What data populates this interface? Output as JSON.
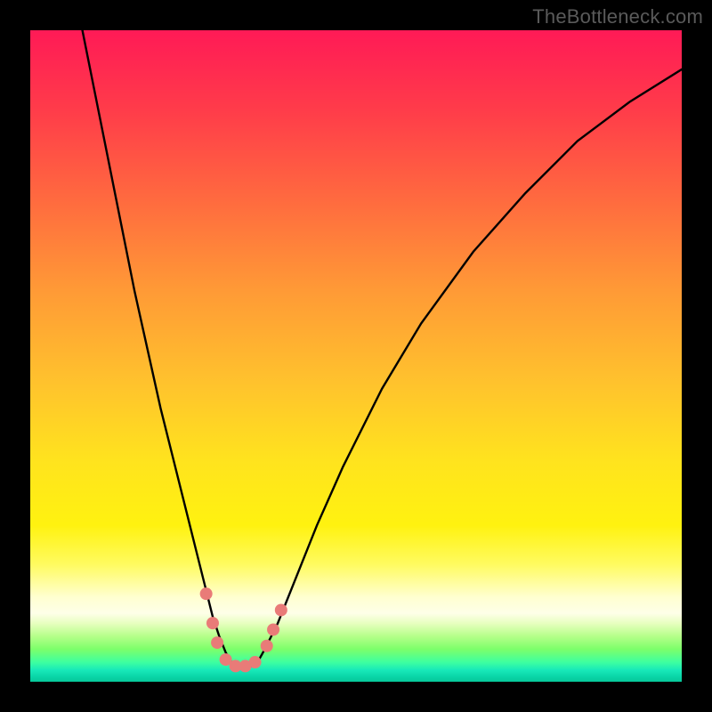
{
  "watermark": "TheBottleneck.com",
  "chart_data": {
    "type": "line",
    "title": "",
    "xlabel": "",
    "ylabel": "",
    "xlim": [
      0,
      100
    ],
    "ylim": [
      0,
      100
    ],
    "grid": false,
    "legend": false,
    "series": [
      {
        "name": "bottleneck-curve",
        "color": "#000000",
        "x": [
          8,
          10,
          12,
          14,
          16,
          18,
          20,
          22,
          24,
          26,
          27,
          28,
          29,
          30,
          31,
          32,
          33,
          34,
          35,
          36,
          38,
          40,
          44,
          48,
          54,
          60,
          68,
          76,
          84,
          92,
          100
        ],
        "y": [
          100,
          90,
          80,
          70,
          60,
          51,
          42,
          34,
          26,
          18,
          14,
          10,
          7,
          4.5,
          2.8,
          2.0,
          2.0,
          2.4,
          3.2,
          5,
          9,
          14,
          24,
          33,
          45,
          55,
          66,
          75,
          83,
          89,
          94
        ]
      }
    ],
    "markers": [
      {
        "name": "marker-left-upper",
        "x": 27.0,
        "y": 13.5
      },
      {
        "name": "marker-left-mid",
        "x": 28.0,
        "y": 9.0
      },
      {
        "name": "marker-left-lower",
        "x": 28.7,
        "y": 6.0
      },
      {
        "name": "marker-trough-1",
        "x": 30.0,
        "y": 3.4
      },
      {
        "name": "marker-trough-2",
        "x": 31.5,
        "y": 2.4
      },
      {
        "name": "marker-trough-3",
        "x": 33.0,
        "y": 2.4
      },
      {
        "name": "marker-trough-4",
        "x": 34.5,
        "y": 3.0
      },
      {
        "name": "marker-right-lower",
        "x": 36.3,
        "y": 5.5
      },
      {
        "name": "marker-right-mid",
        "x": 37.3,
        "y": 8.0
      },
      {
        "name": "marker-right-upper",
        "x": 38.5,
        "y": 11.0
      }
    ],
    "marker_style": {
      "fill": "#e97b78",
      "radius_px": 7
    },
    "gradient_stops": [
      {
        "pct": 0,
        "color": "#ff1a56"
      },
      {
        "pct": 26,
        "color": "#ff6a3f"
      },
      {
        "pct": 54,
        "color": "#ffc22d"
      },
      {
        "pct": 76,
        "color": "#fff210"
      },
      {
        "pct": 90,
        "color": "#feffe8"
      },
      {
        "pct": 95,
        "color": "#7dff6a"
      },
      {
        "pct": 100,
        "color": "#06c79a"
      }
    ]
  }
}
